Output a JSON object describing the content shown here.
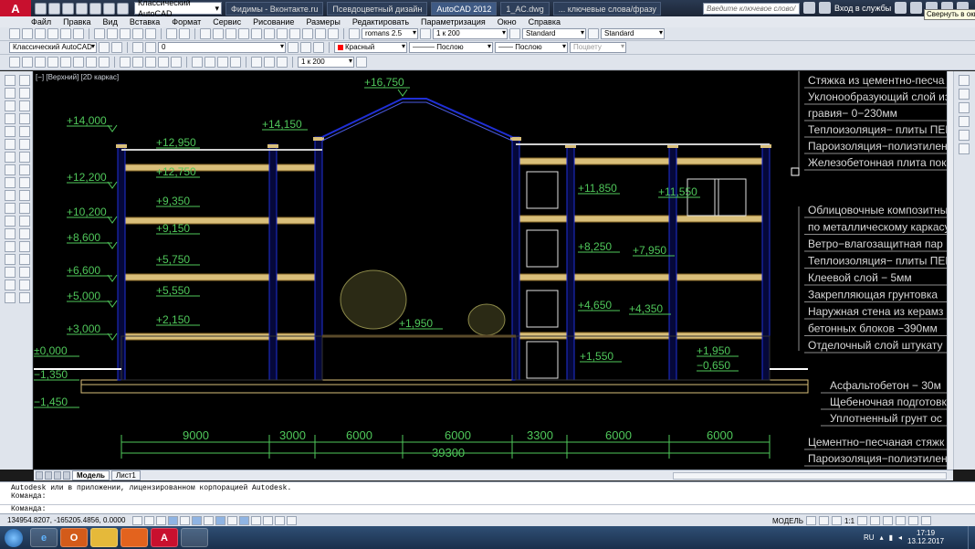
{
  "titlebar": {
    "logo": "A",
    "workspace": "Классический AutoCAD",
    "tabs": [
      "Фидимы - Вконтакте.ru",
      "Псевдоцветный дизайн",
      "AutoCAD 2012",
      "1_АС.dwg",
      "... ключевые слова/фразу"
    ],
    "search_placeholder": "Введите ключевое слово/фразу",
    "signin": "Вход в службы",
    "tooltip": "Свернуть в окно"
  },
  "menu": [
    "Файл",
    "Правка",
    "Вид",
    "Вставка",
    "Формат",
    "Сервис",
    "Рисование",
    "Размеры",
    "Редактировать",
    "Параметризация",
    "Окно",
    "Справка"
  ],
  "toolbar1": {
    "text_style": "romans 2.5",
    "dim_scale": "1 к 200",
    "dim_style": "Standard",
    "table_style": "Standard"
  },
  "toolbar2": {
    "workspace": "Классический AutoCAD",
    "layer": "0",
    "color": "Красный",
    "linetype": "Послою",
    "lineweight": "Послою",
    "plotstyle": "Поцвету"
  },
  "toolbar3": {
    "scale": "1 к 200"
  },
  "viewport_label": "[−] [Верхний] [2D каркас]",
  "drawing": {
    "elevations_left": [
      "+14,000",
      "+12,200",
      "+10,200",
      "+8,600",
      "+6,600",
      "+5,000",
      "+3,000",
      "±0,000",
      "−1,350",
      "−1,450"
    ],
    "elevations_inner": [
      "+12,950",
      "+12,750",
      "+9,350",
      "+9,150",
      "+5,750",
      "+5,550",
      "+2,150"
    ],
    "elevations_top": [
      "+16,750",
      "+14,150"
    ],
    "elevations_right": [
      "+11,850",
      "+11,550",
      "+8,250",
      "+7,950",
      "+4,650",
      "+4,350",
      "+1,550",
      "+1,950",
      "−0,650"
    ],
    "elevation_ground": "+1,950",
    "dimensions": [
      "9000",
      "3000",
      "6000",
      "6000",
      "3300",
      "6000",
      "6000"
    ],
    "total_dimension": "39300",
    "callouts_roof": [
      "Стяжка из цементно-песча",
      "Уклонообразующий слой из",
      "гравия− 0−230мм",
      "Теплоизоляция− плиты ПЕН",
      "Пароизоляция−полиэтилен",
      "Железобетонная плита пок"
    ],
    "callouts_wall": [
      "Облицовочные композитные",
      "по металлическому каркасу",
      "Ветро−влагозащитная пар",
      "Теплоизоляция− плиты ПЕН",
      "Клеевой слой − 5мм",
      "Закрепляющая грунтовка",
      "Наружная стена из керамз",
      "бетонных блоков −390мм",
      "Отделочный слой штукату"
    ],
    "callouts_floor": [
      "Асфальтобетон − 30м",
      "Щебеночная подготовк",
      "Уплотненный грунт ос"
    ],
    "callouts_bottom": [
      "Цементно−песчаная стяжк",
      "Пароизоляция−полиэтиленов"
    ]
  },
  "layout_tabs": [
    "Модель",
    "Лист1"
  ],
  "command": {
    "history_line": "Autodesk или в приложении, лицензированном корпорацией Autodesk.",
    "history_prompt": "Команда:",
    "input_prompt": "Команда:"
  },
  "status": {
    "coords": "134954.8207, -165205.4856, 0.0000",
    "model": "МОДЕЛЬ",
    "scale": "1:1"
  },
  "taskbar": {
    "lang": "RU",
    "time": "17:19",
    "date": "13.12.2017"
  },
  "colors": {
    "background": "#000000",
    "structure": "#d9bf7a",
    "columns": "#1f2fd6",
    "text": "#4fc75a",
    "callout_box": "#c8c8c8"
  }
}
